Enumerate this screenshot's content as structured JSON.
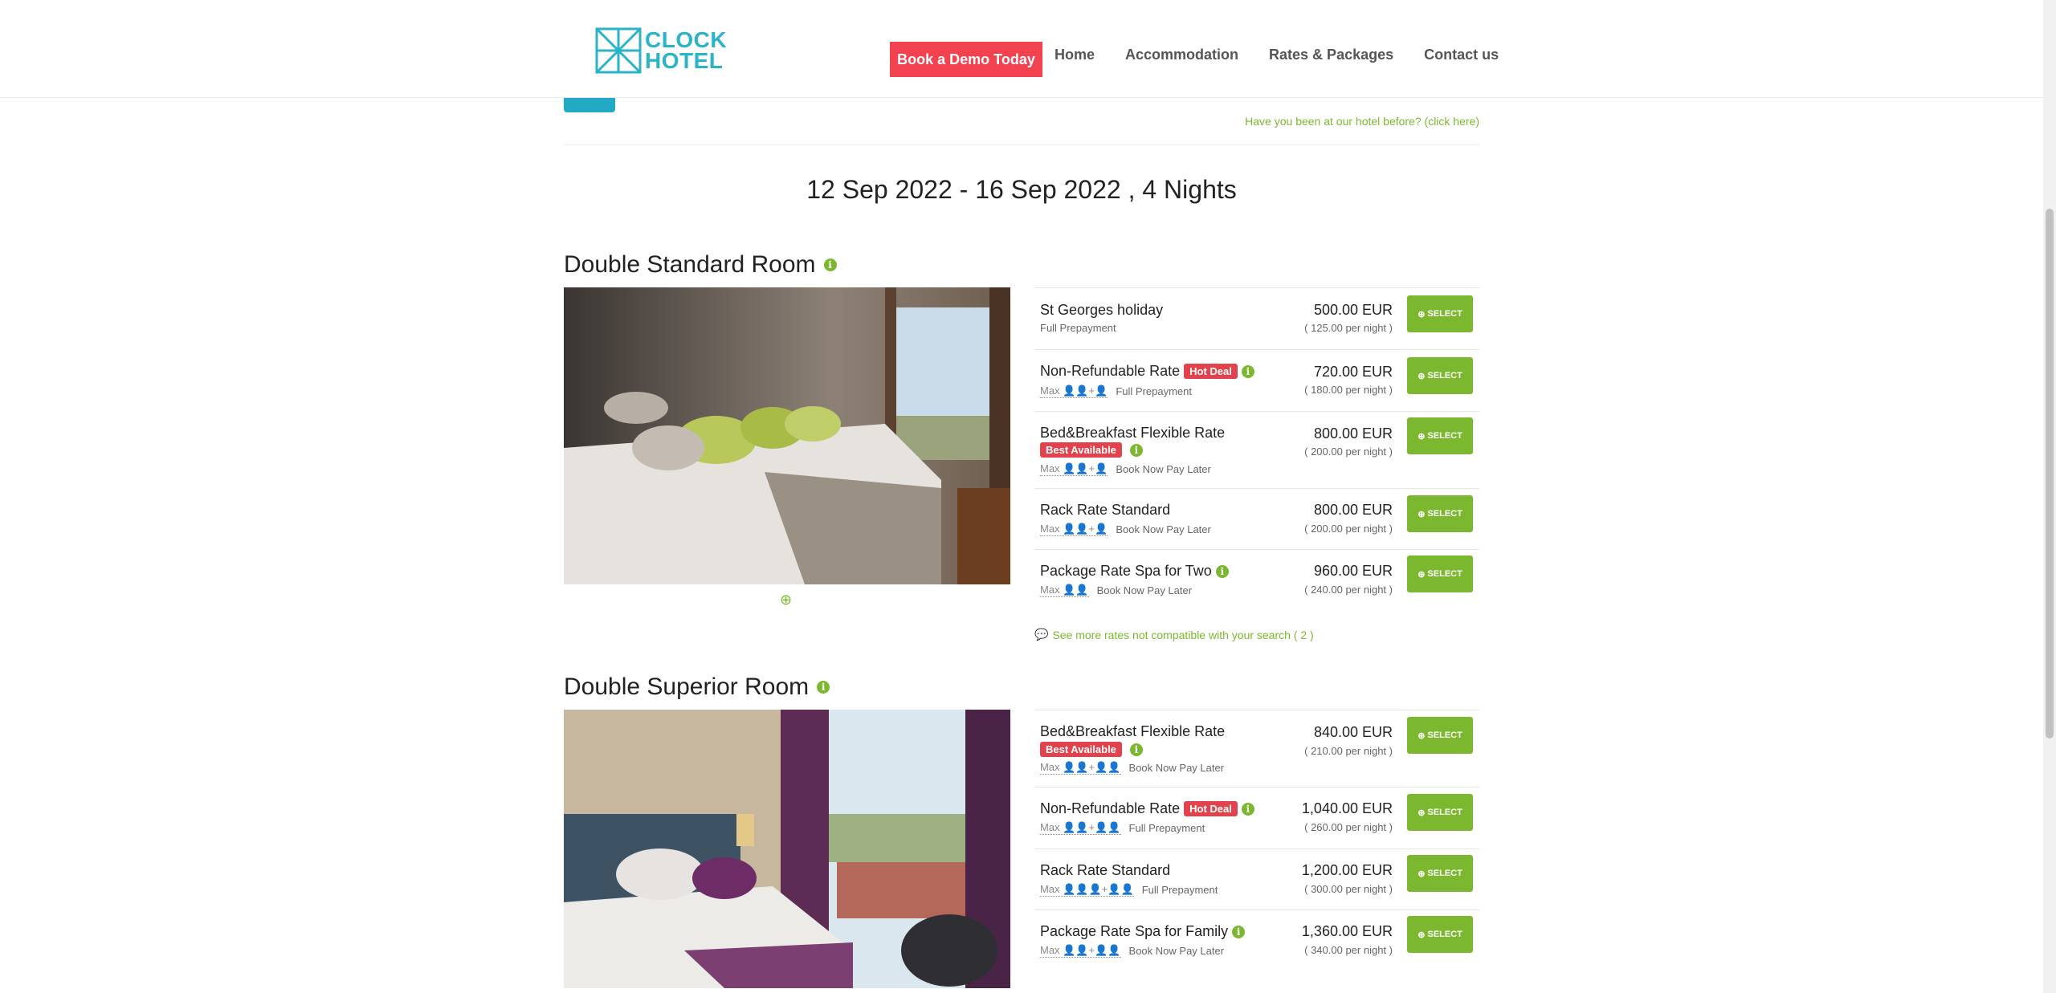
{
  "header": {
    "logo_line1": "CLOCK",
    "logo_line2": "HOTEL",
    "demo_button": "Book a Demo Today",
    "nav": [
      "Home",
      "Accommodation",
      "Rates & Packages",
      "Contact us"
    ]
  },
  "returning_link": "Have you been at our hotel before? (click here)",
  "stay_dates": "12 Sep 2022 - 16 Sep 2022 , 4 Nights",
  "select_label": "SELECT",
  "max_label": "Max",
  "rooms": [
    {
      "title": "Double Standard Room",
      "more_rates_link": "See more rates not compatible with your search ( 2 )",
      "rates": [
        {
          "name": "St Georges holiday",
          "badge": "",
          "info": false,
          "occupancy": "",
          "payment": "Full Prepayment",
          "price": "500.00 EUR",
          "per_night": "( 125.00 per night )"
        },
        {
          "name": "Non-Refundable Rate",
          "badge": "Hot Deal",
          "info": true,
          "occupancy": "👤👤+👤",
          "payment": "Full Prepayment",
          "price": "720.00 EUR",
          "per_night": "( 180.00 per night )"
        },
        {
          "name": "Bed&Breakfast Flexible Rate",
          "badge": "Best Available",
          "info": true,
          "occupancy": "👤👤+👤",
          "payment": "Book Now Pay Later",
          "price": "800.00 EUR",
          "per_night": "( 200.00 per night )"
        },
        {
          "name": "Rack Rate Standard",
          "badge": "",
          "info": false,
          "occupancy": "👤👤+👤",
          "payment": "Book Now Pay Later",
          "price": "800.00 EUR",
          "per_night": "( 200.00 per night )"
        },
        {
          "name": "Package Rate Spa for Two",
          "badge": "",
          "info": true,
          "occupancy": "👤👤",
          "payment": "Book Now Pay Later",
          "price": "960.00 EUR",
          "per_night": "( 240.00 per night )"
        }
      ]
    },
    {
      "title": "Double Superior Room",
      "rates": [
        {
          "name": "Bed&Breakfast Flexible Rate",
          "badge": "Best Available",
          "info": true,
          "occupancy": "👤👤+👤👤",
          "payment": "Book Now Pay Later",
          "price": "840.00 EUR",
          "per_night": "( 210.00 per night )"
        },
        {
          "name": "Non-Refundable Rate",
          "badge": "Hot Deal",
          "info": true,
          "occupancy": "👤👤+👤👤",
          "payment": "Full Prepayment",
          "price": "1,040.00 EUR",
          "per_night": "( 260.00 per night )"
        },
        {
          "name": "Rack Rate Standard",
          "badge": "",
          "info": false,
          "occupancy": "👤👤👤+👤👤",
          "payment": "Full Prepayment",
          "price": "1,200.00 EUR",
          "per_night": "( 300.00 per night )"
        },
        {
          "name": "Package Rate Spa for Family",
          "badge": "",
          "info": true,
          "occupancy": "👤👤+👤👤",
          "payment": "Book Now Pay Later",
          "price": "1,360.00 EUR",
          "per_night": "( 340.00 per night )"
        }
      ]
    }
  ],
  "colors": {
    "accent_green": "#7cb82f",
    "brand_teal": "#2bb3c8",
    "demo_red": "#f3424f",
    "badge_red": "#e2424b"
  }
}
